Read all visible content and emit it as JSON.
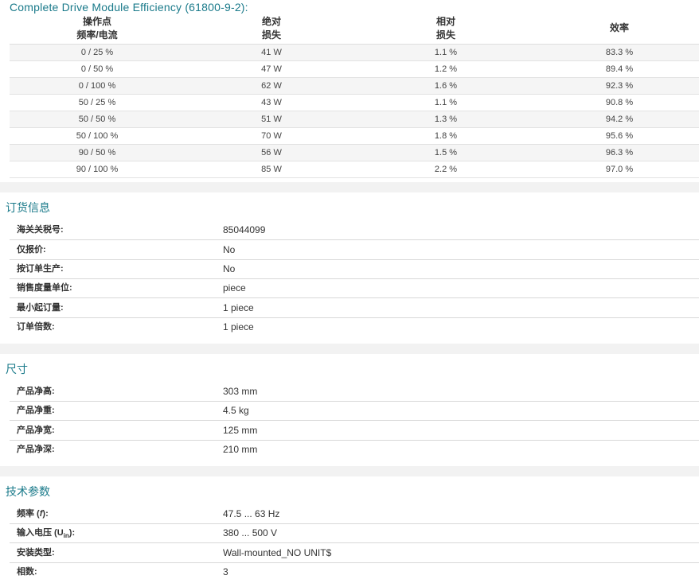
{
  "efficiency": {
    "title": "Complete Drive Module Efficiency (61800-9-2):",
    "headers": {
      "op_line1": "操作点",
      "op_line2": "频率/电流",
      "abs_line1": "绝对",
      "abs_line2": "损失",
      "rel_line1": "相对",
      "rel_line2": "损失",
      "eff": "效率"
    },
    "rows": [
      {
        "op": "0 / 25 %",
        "abs": "41 W",
        "rel": "1.1 %",
        "eff": "83.3 %"
      },
      {
        "op": "0 / 50 %",
        "abs": "47 W",
        "rel": "1.2 %",
        "eff": "89.4 %"
      },
      {
        "op": "0 / 100 %",
        "abs": "62 W",
        "rel": "1.6 %",
        "eff": "92.3 %"
      },
      {
        "op": "50 / 25 %",
        "abs": "43 W",
        "rel": "1.1 %",
        "eff": "90.8 %"
      },
      {
        "op": "50 / 50 %",
        "abs": "51 W",
        "rel": "1.3 %",
        "eff": "94.2 %"
      },
      {
        "op": "50 / 100 %",
        "abs": "70 W",
        "rel": "1.8 %",
        "eff": "95.6 %"
      },
      {
        "op": "90 / 50 %",
        "abs": "56 W",
        "rel": "1.5 %",
        "eff": "96.3 %"
      },
      {
        "op": "90 / 100 %",
        "abs": "85 W",
        "rel": "2.2 %",
        "eff": "97.0 %"
      }
    ]
  },
  "ordering": {
    "title": "订货信息",
    "items": [
      {
        "label": "海关关税号:",
        "value": "85044099"
      },
      {
        "label": "仅报价:",
        "value": "No"
      },
      {
        "label": "按订单生产:",
        "value": "No"
      },
      {
        "label": "销售度量单位:",
        "value": "piece"
      },
      {
        "label": "最小起订量:",
        "value": "1 piece"
      },
      {
        "label": "订单倍数:",
        "value": "1 piece"
      }
    ]
  },
  "dimensions": {
    "title": "尺寸",
    "items": [
      {
        "label": "产品净高:",
        "value": "303 mm"
      },
      {
        "label": "产品净重:",
        "value": "4.5 kg"
      },
      {
        "label": "产品净宽:",
        "value": "125 mm"
      },
      {
        "label": "产品净深:",
        "value": "210 mm"
      }
    ]
  },
  "technical": {
    "title": "技术参数",
    "items": [
      {
        "label_pre": "频率 (",
        "label_sym": "f",
        "label_post": "):",
        "value": "47.5 ... 63 Hz"
      },
      {
        "label_pre": "输入电压 (U",
        "label_sub": "in",
        "label_post": "):",
        "value": "380 ... 500 V"
      },
      {
        "label": "安装类型:",
        "value": "Wall-mounted_NO UNIT$"
      },
      {
        "label": "相数:",
        "value": "3"
      }
    ]
  },
  "colors": {
    "accent": "#1a7a8a",
    "stripe": "#f5f5f5",
    "gap": "#f2f2f2"
  }
}
